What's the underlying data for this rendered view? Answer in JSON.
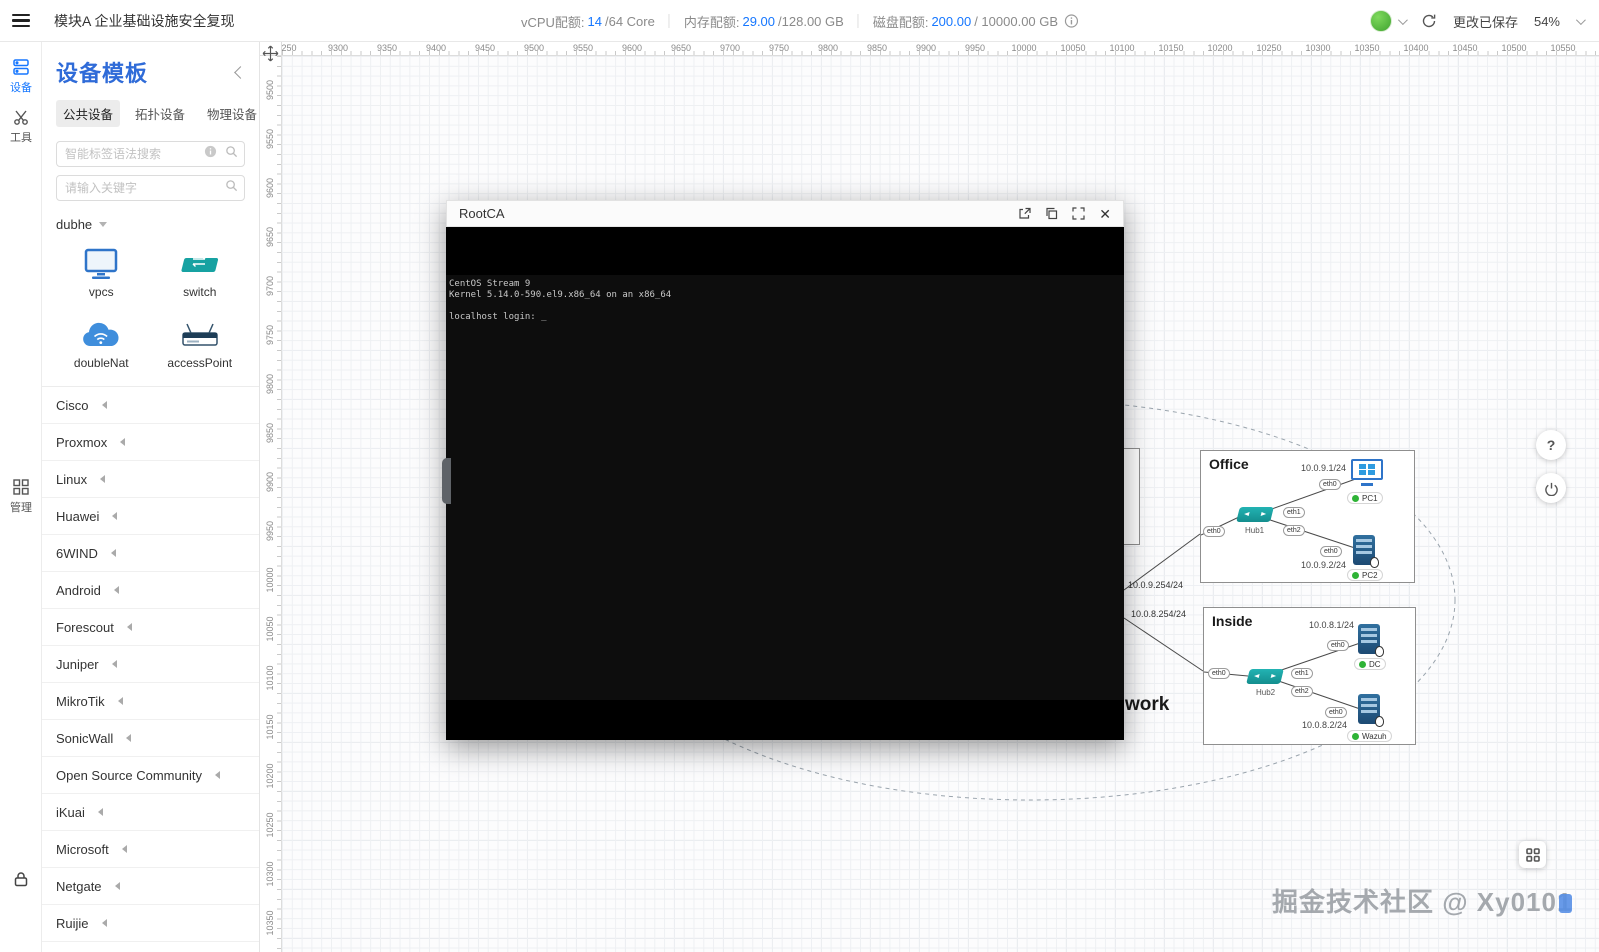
{
  "header": {
    "app_title": "模块A 企业基础设施安全复现",
    "quota": {
      "vcpu_label": "vCPU配额:",
      "vcpu_value": "14",
      "vcpu_suffix": "/64 Core",
      "mem_label": "内存配额:",
      "mem_value": "29.00",
      "mem_suffix": "/128.00 GB",
      "disk_label": "磁盘配额:",
      "disk_value": "200.00",
      "disk_suffix": "/ 10000.00 GB"
    },
    "save_status": "更改已保存",
    "zoom_value": "54%"
  },
  "rail": {
    "devices": "设备",
    "tools": "工具",
    "manage": "管理"
  },
  "sidebar": {
    "title": "设备模板",
    "tabs": [
      "公共设备",
      "拓扑设备",
      "物理设备"
    ],
    "smart_search_placeholder": "智能标签语法搜索",
    "keyword_placeholder": "请输入关键字",
    "expanded_group": {
      "name": "dubhe",
      "devices": [
        {
          "label": "vpcs",
          "icon": "monitor-icon"
        },
        {
          "label": "switch",
          "icon": "switch-icon"
        },
        {
          "label": "doubleNat",
          "icon": "cloud-icon"
        },
        {
          "label": "accessPoint",
          "icon": "access-point-icon"
        }
      ]
    },
    "groups": [
      "Cisco",
      "Proxmox",
      "Linux",
      "Huawei",
      "6WIND",
      "Android",
      "Forescout",
      "Juniper",
      "MikroTik",
      "SonicWall",
      "Open Source Community",
      "iKuai",
      "Microsoft",
      "Netgate",
      "Ruijie"
    ]
  },
  "ruler": {
    "h": [
      "250",
      "9300",
      "9350",
      "9400",
      "9450",
      "9500",
      "9550",
      "9600",
      "9650",
      "9700",
      "9750",
      "9800",
      "9850",
      "9900",
      "9950",
      "10000",
      "10050",
      "10100",
      "10150",
      "10200",
      "10250",
      "10300",
      "10350",
      "10400",
      "10450",
      "10500",
      "10550"
    ],
    "v": [
      "9500",
      "9550",
      "9600",
      "9650",
      "9700",
      "9750",
      "9800",
      "9850",
      "9900",
      "9950",
      "10000",
      "10050",
      "10100",
      "10150",
      "10200",
      "10250",
      "10300",
      "10350"
    ]
  },
  "terminal": {
    "title": "RootCA",
    "lines": [
      "CentOS Stream 9",
      "Kernel 5.14.0-590.el9.x86_64 on an x86_64",
      "",
      "localhost login: _"
    ]
  },
  "topology": {
    "partial_label": "work",
    "uplink_labels": [
      "10.0.9.254/24",
      "10.0.8.254/24"
    ],
    "office": {
      "title": "Office",
      "ip_top": "10.0.9.1/24",
      "ip_bottom": "10.0.9.2/24",
      "hub": "Hub1",
      "pc1": "PC1",
      "pc2": "PC2",
      "ports": {
        "uplink": "eth0",
        "to_pc1": "eth1",
        "to_pc2": "eth2",
        "pc1_nic": "eth0",
        "pc2_nic": "eth0"
      }
    },
    "inside": {
      "title": "Inside",
      "ip_top": "10.0.8.1/24",
      "ip_bottom": "10.0.8.2/24",
      "hub": "Hub2",
      "dc": "DC",
      "wazuh": "Wazuh",
      "ports": {
        "uplink": "eth0",
        "to_dc": "eth1",
        "to_wazuh": "eth2",
        "dc_nic": "eth0",
        "wazuh_nic": "eth0"
      }
    }
  },
  "watermark": "掘金技术社区 @ Xy0101"
}
